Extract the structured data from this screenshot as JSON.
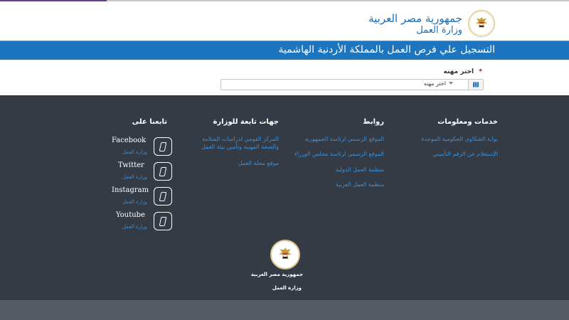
{
  "header": {
    "line1": "جمهورية مصر العربية",
    "line2": "وزارة العمل"
  },
  "title": "التسجيل علي فرص العمل بالمملكة الأردنية الهاشمية",
  "form": {
    "label": "اختر مهنه",
    "required_mark": "*",
    "select_value": "اختر مهنه"
  },
  "footer": {
    "services": {
      "title": "خدمات ومعلومات",
      "links": [
        "بوابة الشكاوي الحكومية الموحدة",
        "الإستعلام عن الرقم التأميني"
      ]
    },
    "links_col": {
      "title": "روابط",
      "links": [
        "الموقع الرسمي لرئاسة الجمهورية",
        "الموقع الرسمي لرئاسة مجلس الوزراء",
        "منظمة العمل الدولية",
        "منظمة العمل العربية"
      ]
    },
    "affiliates": {
      "title": "جهات تابعة للوزارة",
      "links": [
        "المركز القومي لدراسات السلامة والصحة المهنية وتأمين بيئة العمل",
        "موقع مجلة العمل"
      ]
    },
    "follow": {
      "title": "تابعنا على",
      "items": [
        {
          "name": "Facebook",
          "sub": "وزارة العمل"
        },
        {
          "name": "Twitter",
          "sub": "وزارة العمل"
        },
        {
          "name": "Instagram",
          "sub": "وزارة العمل"
        },
        {
          "name": "Youtube",
          "sub": "وزارة العمل"
        }
      ]
    },
    "bottom_line1": "جمهورية مصر العربية",
    "bottom_line2": "وزارة العمل"
  },
  "colors": {
    "primary_blue": "#1d74bf",
    "footer_bg": "#353b45",
    "link_blue": "#3a8fd8",
    "gold": "#d9c38a"
  }
}
